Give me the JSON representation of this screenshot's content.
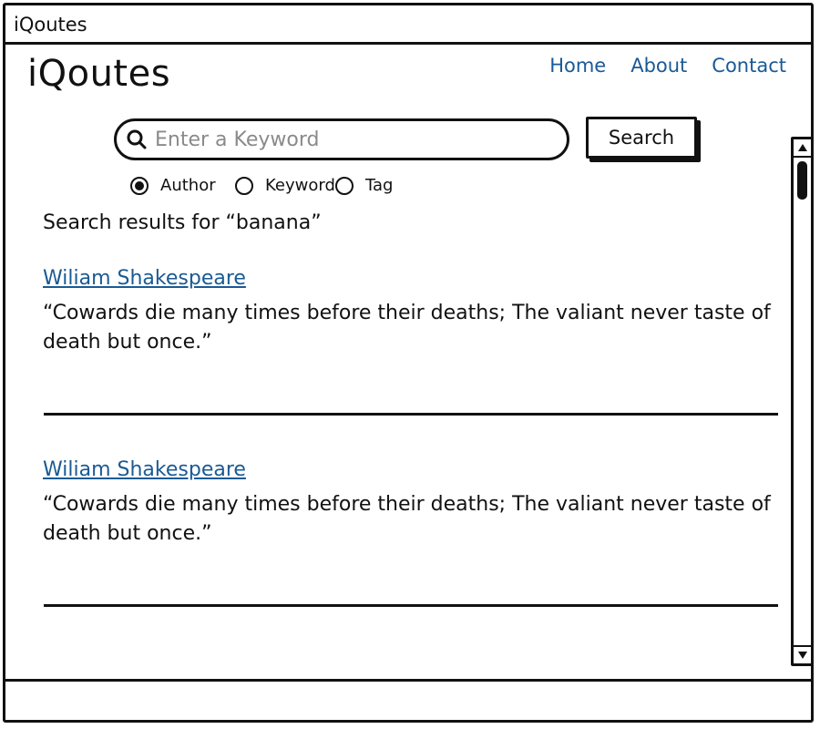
{
  "window": {
    "title": "iQoutes"
  },
  "header": {
    "logo": "iQoutes",
    "nav": [
      {
        "label": "Home"
      },
      {
        "label": "About"
      },
      {
        "label": "Contact"
      }
    ]
  },
  "search": {
    "placeholder": "Enter a Keyword",
    "value": "",
    "button_label": "Search",
    "icon": "search-icon",
    "filters": [
      {
        "label": "Author",
        "checked": true
      },
      {
        "label": "Keyword",
        "checked": false
      },
      {
        "label": "Tag",
        "checked": false
      }
    ]
  },
  "results": {
    "heading": "Search results for “banana”",
    "items": [
      {
        "author": "Wiliam Shakespeare",
        "quote": "“Cowards die many times before their deaths; The valiant never taste of death but once.”"
      },
      {
        "author": "Wiliam Shakespeare",
        "quote": "“Cowards die many times before their deaths; The valiant never taste of death but once.”"
      }
    ]
  },
  "colors": {
    "link": "#1a5a94",
    "ink": "#111111",
    "placeholder": "#8a8a8a"
  }
}
